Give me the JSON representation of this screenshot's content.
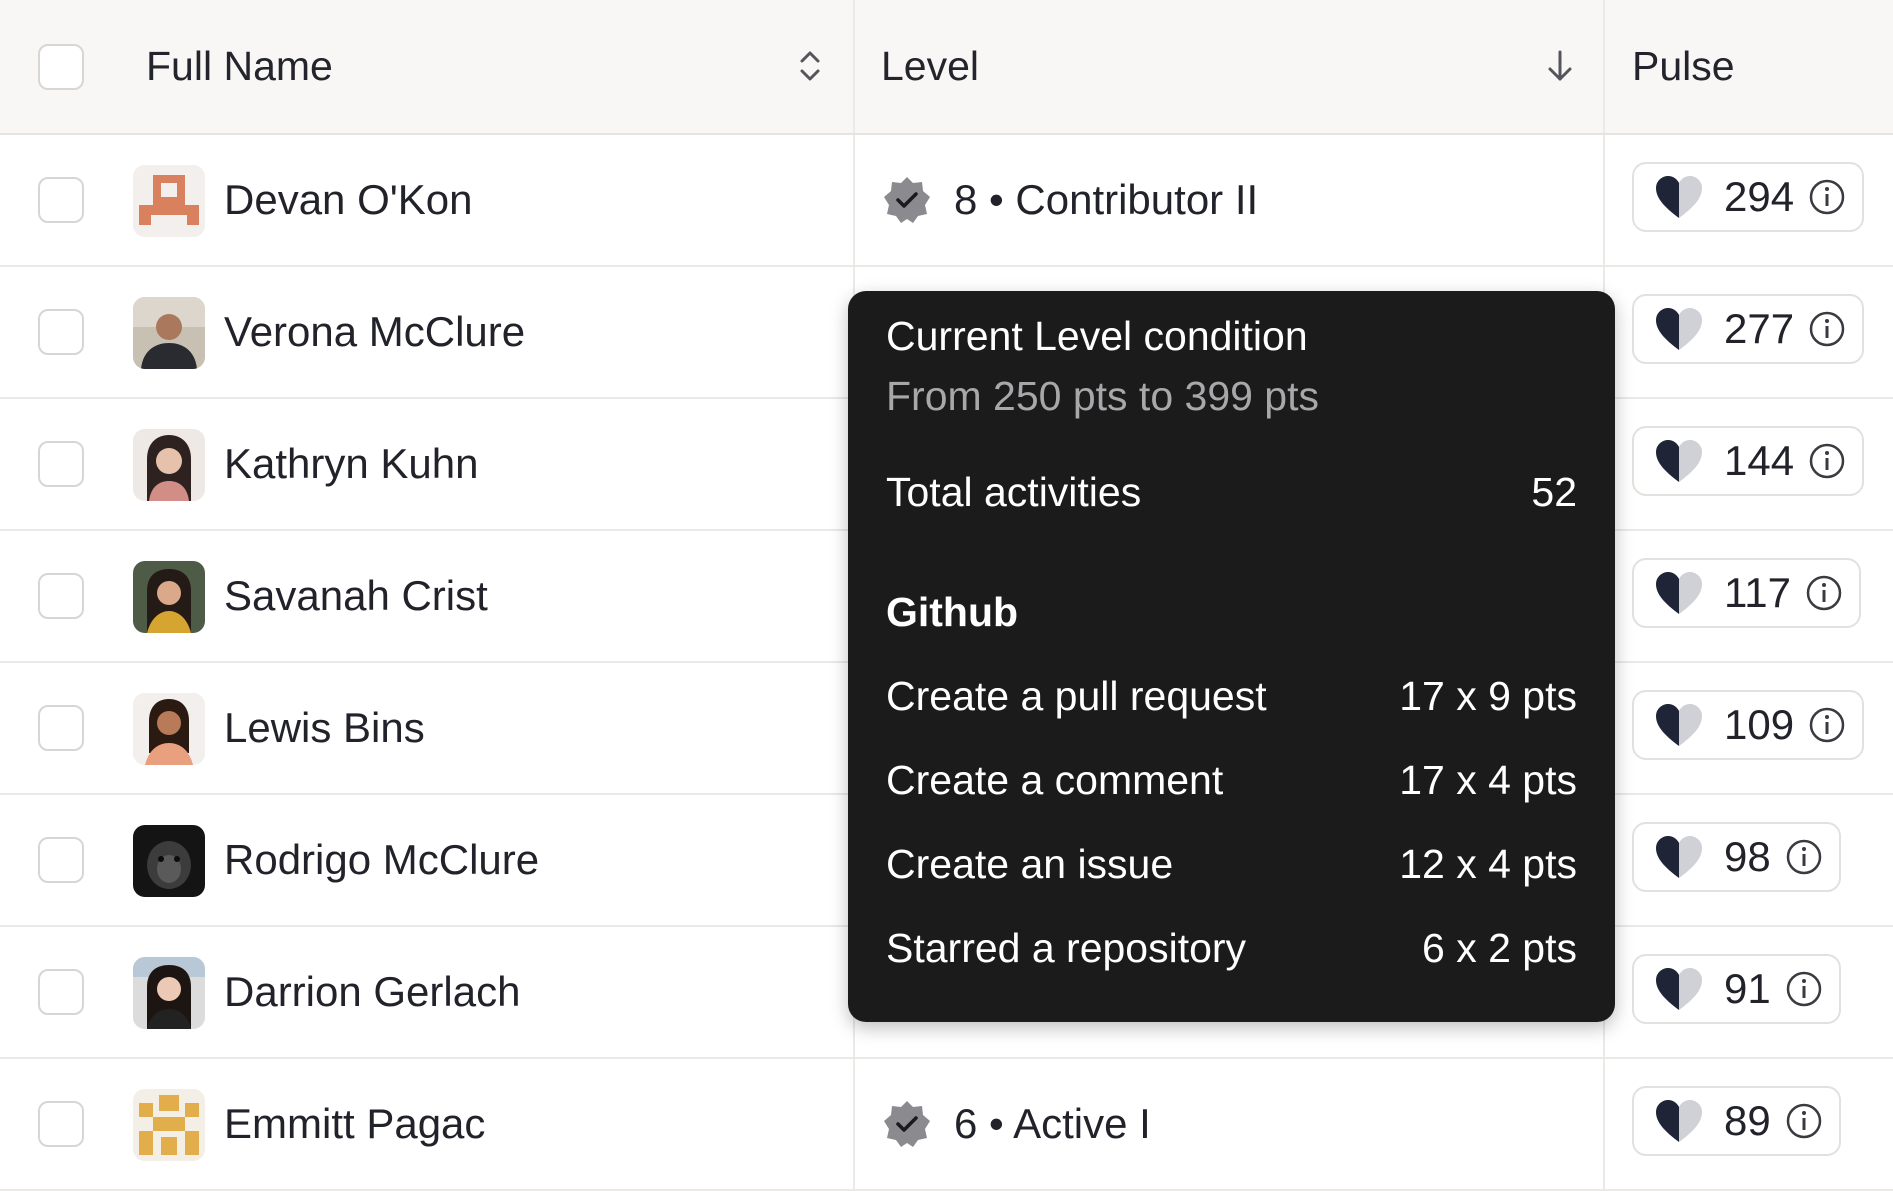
{
  "columns": {
    "full_name": "Full Name",
    "level": "Level",
    "pulse": "Pulse"
  },
  "rows": [
    {
      "name": "Devan O'Kon",
      "level_text": "8 • Contributor II",
      "pulse": "294",
      "avatar": "pixel-avatar-orange"
    },
    {
      "name": "Verona McClure",
      "level_text": "",
      "pulse": "277",
      "avatar": "photo-avatar"
    },
    {
      "name": "Kathryn Kuhn",
      "level_text": "",
      "pulse": "144",
      "avatar": "photo-avatar"
    },
    {
      "name": "Savanah Crist",
      "level_text": "",
      "pulse": "117",
      "avatar": "photo-avatar"
    },
    {
      "name": "Lewis Bins",
      "level_text": "",
      "pulse": "109",
      "avatar": "photo-avatar"
    },
    {
      "name": "Rodrigo McClure",
      "level_text": "",
      "pulse": "98",
      "avatar": "photo-avatar-dark"
    },
    {
      "name": "Darrion Gerlach",
      "level_text": "",
      "pulse": "91",
      "avatar": "photo-avatar"
    },
    {
      "name": "Emmitt Pagac",
      "level_text": "6 • Active I",
      "pulse": "89",
      "avatar": "pixel-avatar-gold"
    }
  ],
  "tooltip": {
    "title": "Current Level condition",
    "subtitle": "From 250 pts to 399 pts",
    "total_label": "Total activities",
    "total_value": "52",
    "section": "Github",
    "items": [
      {
        "label": "Create a pull request",
        "value": "17 x 9 pts"
      },
      {
        "label": "Create a comment",
        "value": "17 x 4 pts"
      },
      {
        "label": "Create an issue",
        "value": "12 x 4 pts"
      },
      {
        "label": "Starred a repository",
        "value": "6 x 2 pts"
      }
    ]
  },
  "colors": {
    "tooltip_bg": "#1b1b1c",
    "heart_dark": "#1f2436",
    "heart_light": "#cfd1d6",
    "badge": "#8a8a8f"
  }
}
